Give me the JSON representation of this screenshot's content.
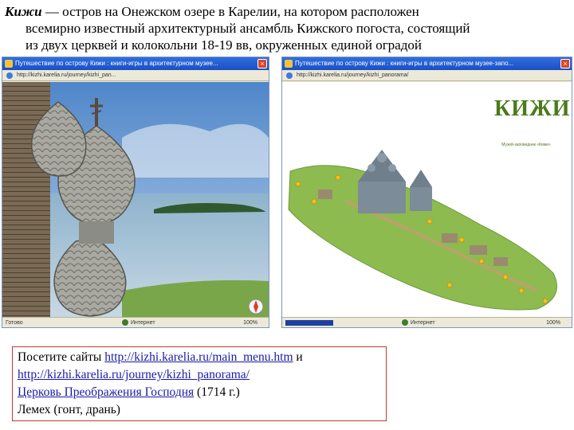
{
  "intro": {
    "term": "Кижи",
    "line1_rest": " — остров на Онежском озере в Карелии, на котором расположен",
    "line2": "всемирно известный архитектурный ансамбль Кижского погоста, состоящий",
    "line3": "из двух церквей и колокольни 18-19 вв, окруженных единой оградой"
  },
  "left_window": {
    "title": "Путешествие по острову Кижи : книги-игры в архитектурном музее...",
    "address": "http://kizhi.karelia.ru/journey/kizhi_pan...",
    "status_left": "Готово",
    "status_zone": "Интернет",
    "status_zoom": "100%"
  },
  "right_window": {
    "title": "Путешествие по острову Кижи : книги-игры в архитектурном музее-запо...",
    "address": "http://kizhi.karelia.ru/journey/kizhi_panorama/",
    "status_zone": "Интернет",
    "status_zoom": "100%",
    "logo_text": "КИЖИ",
    "logo_caption": "Музей-заповедник «Кижи»"
  },
  "info": {
    "visit_prefix": "Посетите сайты ",
    "link1": "http://kizhi.karelia.ru/main_menu.htm",
    "conj": " и",
    "link2": "http://kizhi.karelia.ru/journey/kizhi_panorama/",
    "church_link": "Церковь Преображения Господня",
    "church_year": " (1714 г.)",
    "lemekh": "Лемех (гонт, дрань)"
  },
  "colors": {
    "titlebar": "#1f57cf",
    "logo_green": "#4a7a1a",
    "link": "#1a1aa6",
    "box_border": "#c0392b"
  }
}
